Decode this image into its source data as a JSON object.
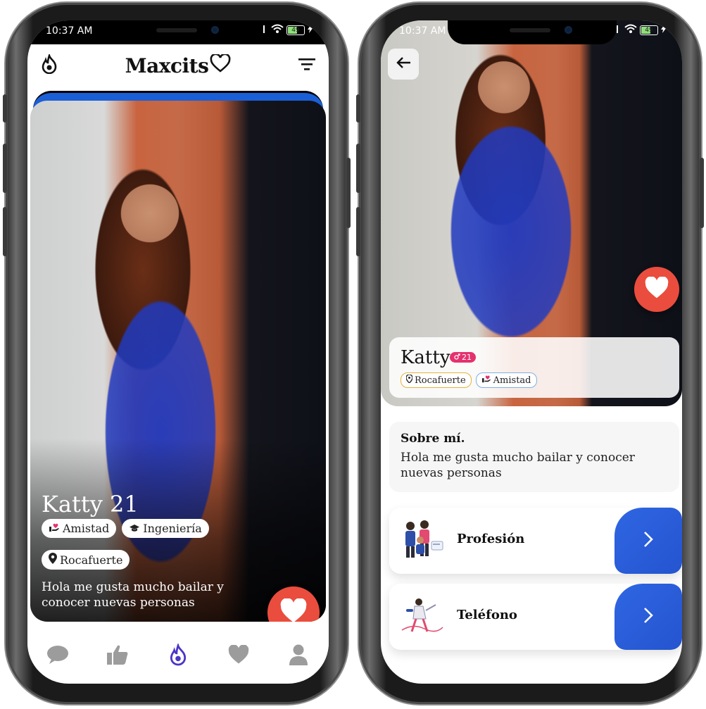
{
  "left_phone": {
    "status": {
      "time": "10:37 AM",
      "battery": "49"
    },
    "header": {
      "brand": "Maxcits",
      "logo_icon": "flame-icon",
      "filter_icon": "filter-icon"
    },
    "card": {
      "name_age": "Katty 21",
      "chips": [
        "Amistad",
        "Ingeniería",
        "Rocafuerte"
      ],
      "bio": "Hola me gusta mucho bailar y conocer nuevas personas"
    },
    "tabbar": [
      "chat-icon",
      "thumbs-up-icon",
      "flame-icon",
      "heart-icon",
      "user-icon"
    ]
  },
  "right_phone": {
    "status": {
      "time": "10:37 AM",
      "battery": "49"
    },
    "profile": {
      "name": "Katty",
      "age": "21",
      "location": "Rocafuerte",
      "interest": "Amistad"
    },
    "about": {
      "title": "Sobre mí.",
      "text": "Hola me gusta mucho bailar y conocer nuevas personas"
    },
    "details": [
      {
        "label": "Profesión",
        "icon": "profession-illustration"
      },
      {
        "label": "Teléfono",
        "icon": "phone-illustration"
      }
    ]
  },
  "colors": {
    "like": "#ea4d3d",
    "accent_blue": "#2f66e3",
    "age_badge": "#e5326e",
    "location_tag": "#e6b23d",
    "friend_tag": "#7fb0e3"
  }
}
